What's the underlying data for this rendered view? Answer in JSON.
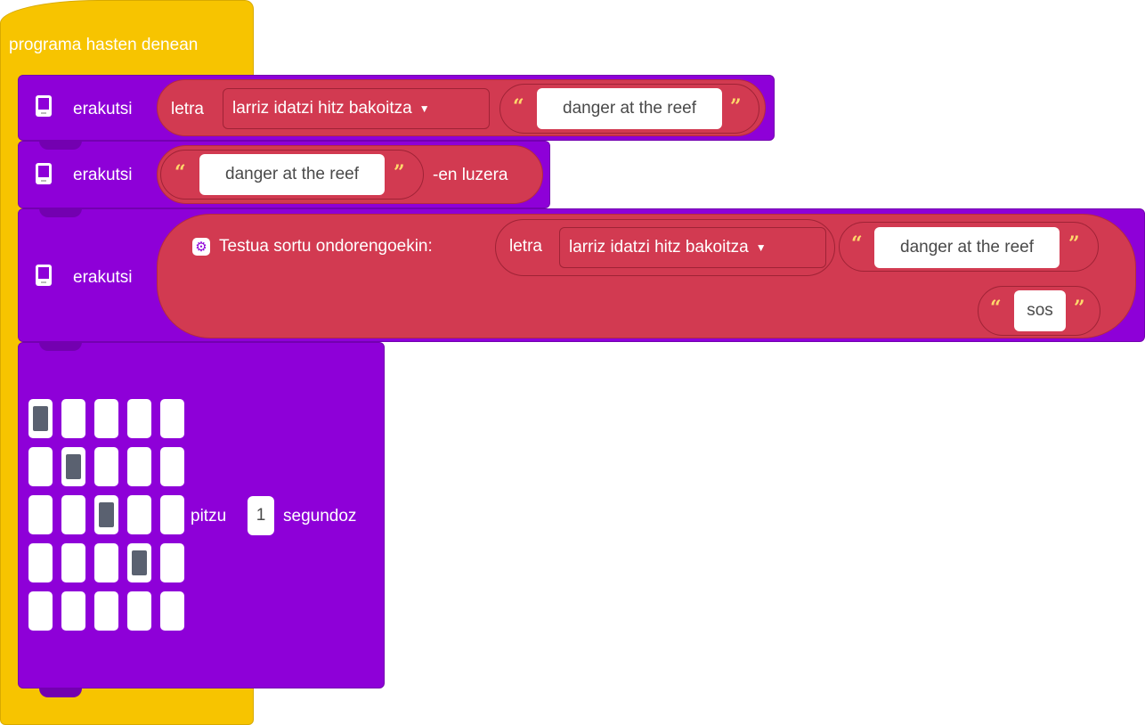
{
  "hat": {
    "label": "programa hasten denean"
  },
  "blocks": [
    {
      "verb": "erakutsi",
      "letra_label": "letra",
      "case_option": "larriz idatzi hitz bakoitza",
      "text": "danger at the reef"
    },
    {
      "verb": "erakutsi",
      "text": "danger at the reef",
      "suffix": "-en luzera"
    },
    {
      "verb": "erakutsi",
      "join_label": "Testua sortu ondorengoekin:",
      "letra_label": "letra",
      "case_option": "larriz idatzi hitz bakoitza",
      "text1": "danger at the reef",
      "text2": "sos"
    },
    {
      "pitzu_label": "pitzu",
      "seconds": "1",
      "segundoz_label": "segundoz",
      "grid": [
        [
          1,
          0,
          0,
          0,
          0
        ],
        [
          0,
          1,
          0,
          0,
          0
        ],
        [
          0,
          0,
          1,
          0,
          0
        ],
        [
          0,
          0,
          0,
          1,
          0
        ],
        [
          0,
          0,
          0,
          0,
          0
        ]
      ]
    }
  ],
  "glyphs": {
    "open_quote": "“",
    "close_quote": "”",
    "caret": "▼",
    "gear": "⚙"
  },
  "colors": {
    "hat": "#f7c400",
    "block": "#8e00d8",
    "text_op": "#d23a51",
    "led_on": "#5a6170"
  }
}
